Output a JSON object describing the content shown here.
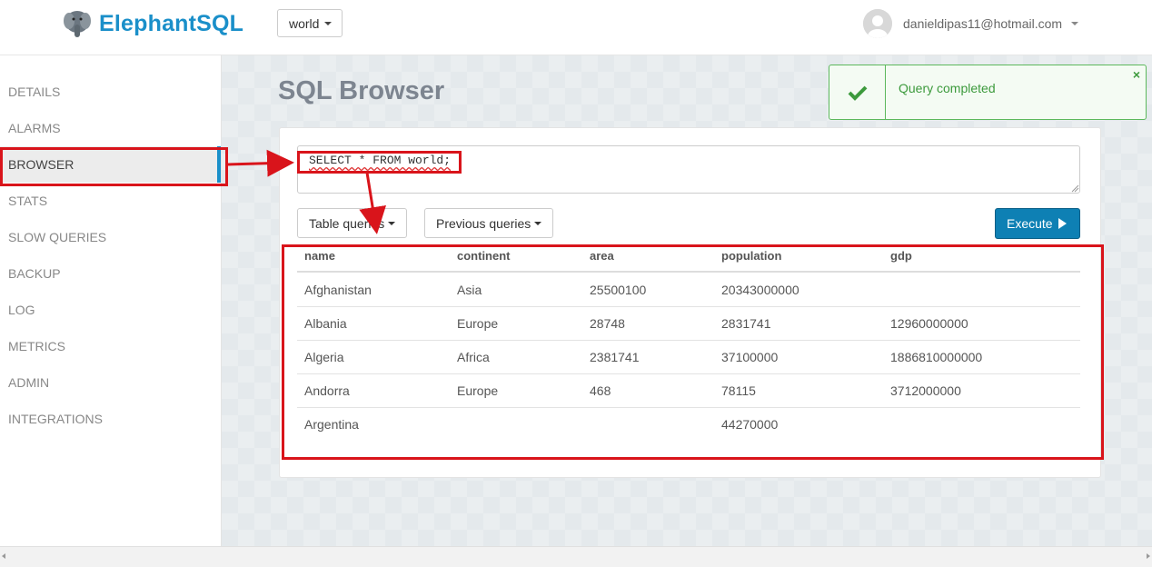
{
  "brand": {
    "name": "ElephantSQL"
  },
  "database_selector": {
    "value": "world"
  },
  "user": {
    "email": "danieldipas11@hotmail.com"
  },
  "sidebar": {
    "items": [
      {
        "label": "DETAILS",
        "active": false
      },
      {
        "label": "ALARMS",
        "active": false
      },
      {
        "label": "BROWSER",
        "active": true
      },
      {
        "label": "STATS",
        "active": false
      },
      {
        "label": "SLOW QUERIES",
        "active": false
      },
      {
        "label": "BACKUP",
        "active": false
      },
      {
        "label": "LOG",
        "active": false
      },
      {
        "label": "METRICS",
        "active": false
      },
      {
        "label": "ADMIN",
        "active": false
      },
      {
        "label": "INTEGRATIONS",
        "active": false
      }
    ]
  },
  "page": {
    "title": "SQL Browser"
  },
  "toast": {
    "message": "Query completed",
    "close": "×",
    "status_color": "#5cb85c"
  },
  "query": {
    "text": "SELECT * FROM world;"
  },
  "toolbar": {
    "table_queries_label": "Table queries",
    "previous_queries_label": "Previous queries",
    "execute_label": "Execute"
  },
  "results": {
    "columns": [
      "name",
      "continent",
      "area",
      "population",
      "gdp"
    ],
    "rows": [
      [
        "Afghanistan",
        "Asia",
        "25500100",
        "20343000000",
        ""
      ],
      [
        "Albania",
        "Europe",
        "28748",
        "2831741",
        "12960000000"
      ],
      [
        "Algeria",
        "Africa",
        "2381741",
        "37100000",
        "1886810000000"
      ],
      [
        "Andorra",
        "Europe",
        "468",
        "78115",
        "3712000000"
      ],
      [
        "Argentina",
        "",
        "",
        "44270000",
        ""
      ]
    ]
  },
  "colors": {
    "brand": "#1a8fc9",
    "execute_button": "#0e80b4",
    "annotation": "#d9141b"
  }
}
